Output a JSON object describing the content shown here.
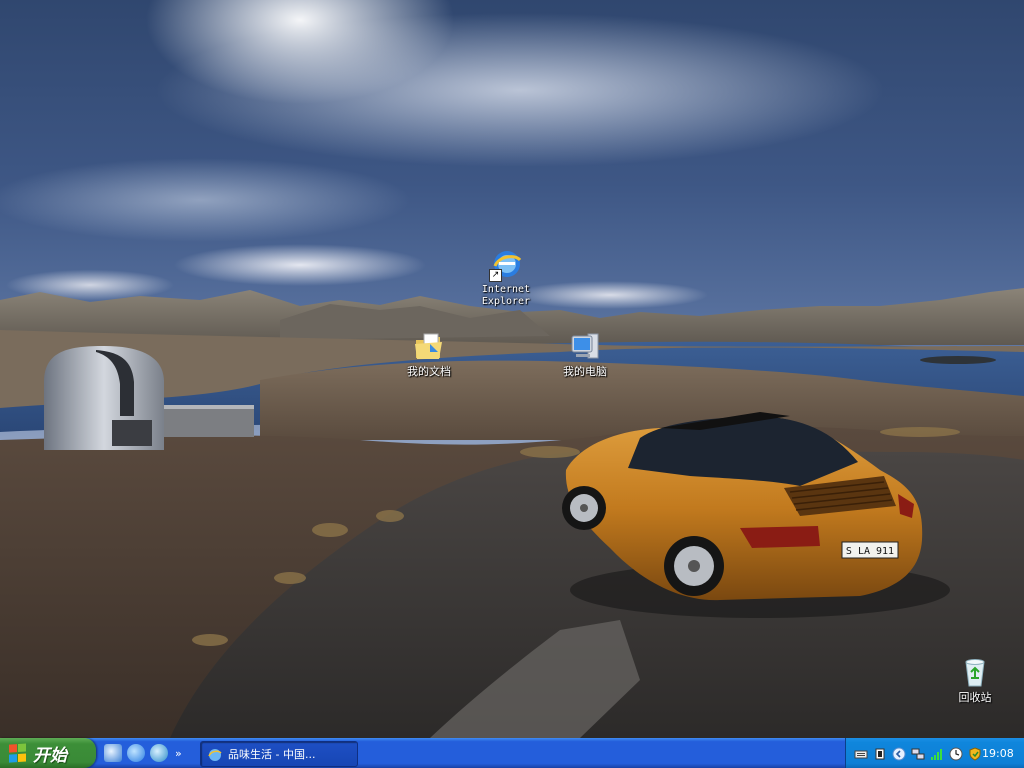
{
  "desktop": {
    "icons": [
      {
        "id": "internet-explorer",
        "label": "Internet\nExplorer",
        "icon": "internet-explorer-icon",
        "shortcut": true
      },
      {
        "id": "my-documents",
        "label": "我的文档",
        "icon": "my-documents-folder-icon"
      },
      {
        "id": "my-computer",
        "label": "我的电脑",
        "icon": "my-computer-icon"
      },
      {
        "id": "recycle-bin",
        "label": "回收站",
        "icon": "recycle-bin-icon"
      }
    ],
    "wallpaper": {
      "license_plate": "S LA 911"
    }
  },
  "taskbar": {
    "start_label": "开始",
    "quicklaunch": [
      "show-desktop-icon",
      "internet-explorer-icon",
      "media-player-icon"
    ],
    "quicklaunch_more": "»",
    "task_label": "品味生活 - 中国...",
    "tray": {
      "icons": [
        "keyboard-icon",
        "input-method-icon",
        "chevron-left-icon",
        "network-icon",
        "signal-bars-icon",
        "clock-sync-icon",
        "security-shield-icon"
      ],
      "clock": "19:08"
    }
  },
  "colors": {
    "taskbar_blue": "#245edb",
    "start_green": "#3c8f38",
    "tray_blue": "#0f86dc",
    "car_orange": "#c27a1e"
  }
}
